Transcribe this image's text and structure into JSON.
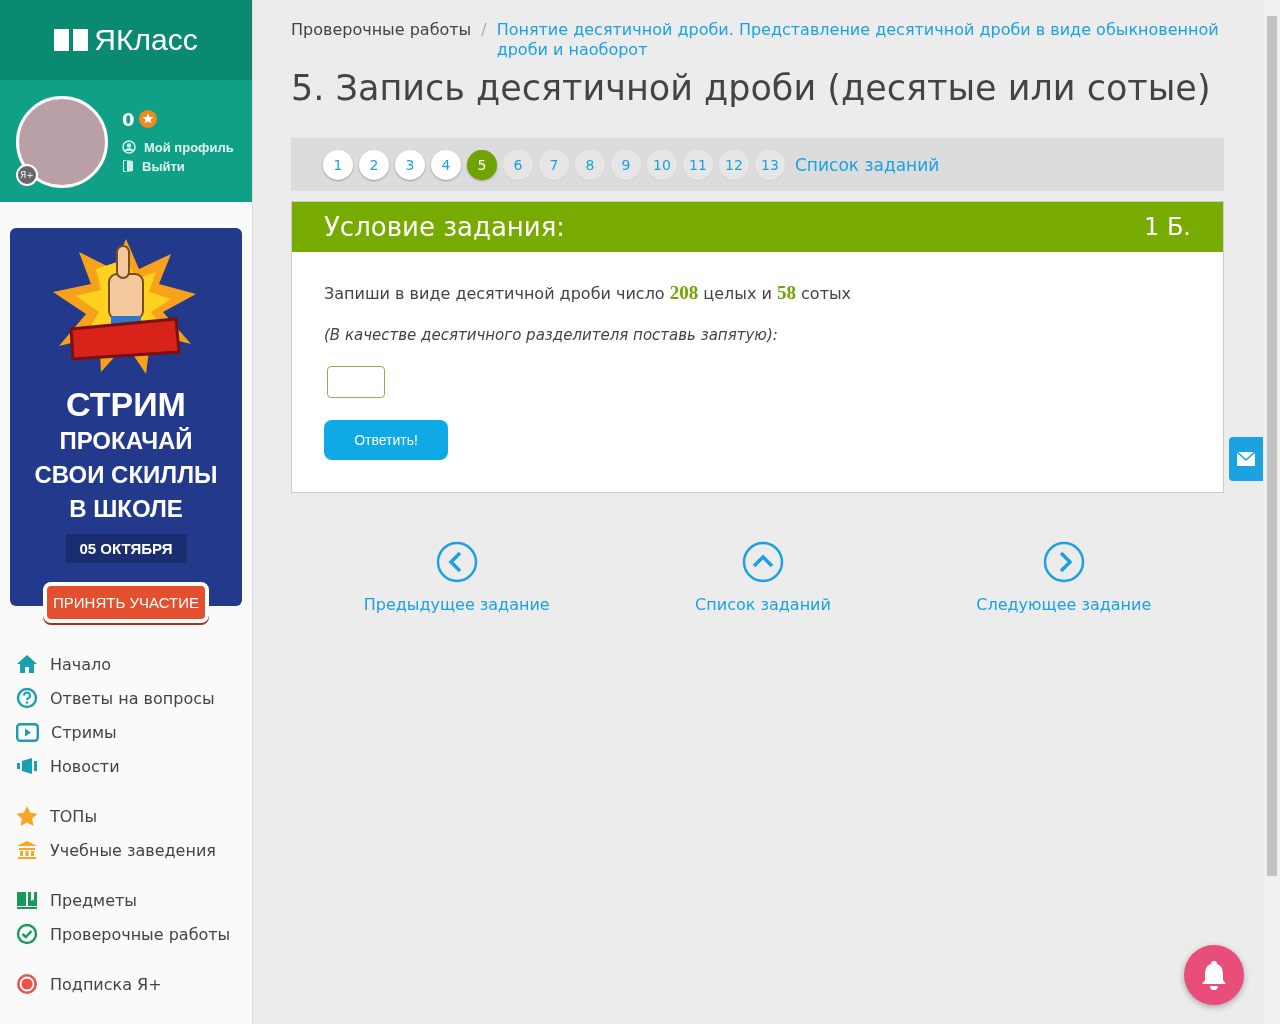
{
  "logo": {
    "text": "ЯКласс"
  },
  "profile": {
    "points": "0",
    "badge": "Я+",
    "links": [
      "Мой профиль",
      "Выйти"
    ]
  },
  "promo": {
    "headline": "СТРИМ",
    "lines": [
      "ПРОКАЧАЙ",
      "СВОИ СКИЛЛЫ",
      "В ШКОЛЕ"
    ],
    "date": "05 ОКТЯБРЯ",
    "button": "ПРИНЯТЬ УЧАСТИЕ"
  },
  "nav_groups": [
    [
      {
        "label": "Начало"
      },
      {
        "label": "Ответы на вопросы"
      },
      {
        "label": "Стримы"
      },
      {
        "label": "Новости"
      }
    ],
    [
      {
        "label": "ТОПы"
      },
      {
        "label": "Учебные заведения"
      }
    ],
    [
      {
        "label": "Предметы"
      },
      {
        "label": "Проверочные работы"
      }
    ],
    [
      {
        "label": "Подписка Я+"
      }
    ]
  ],
  "breadcrumbs": {
    "parent": "Проверочные работы",
    "separator": "/",
    "current": "Понятие десятичной дроби. Представление десятичной дроби в виде обыкновенной дроби и наоборот"
  },
  "title": "5. Запись десятичной дроби (десятые или сотые)",
  "pagination": {
    "pages": [
      {
        "label": "1",
        "selected": false,
        "visited": true
      },
      {
        "label": "2",
        "selected": false,
        "visited": true
      },
      {
        "label": "3",
        "selected": false,
        "visited": true
      },
      {
        "label": "4",
        "selected": false,
        "visited": true
      },
      {
        "label": "5",
        "selected": true,
        "visited": true
      },
      {
        "label": "6",
        "selected": false,
        "visited": false
      },
      {
        "label": "7",
        "selected": false,
        "visited": false
      },
      {
        "label": "8",
        "selected": false,
        "visited": false
      },
      {
        "label": "9",
        "selected": false,
        "visited": false
      },
      {
        "label": "10",
        "selected": false,
        "visited": false
      },
      {
        "label": "11",
        "selected": false,
        "visited": false
      },
      {
        "label": "12",
        "selected": false,
        "visited": false
      },
      {
        "label": "13",
        "selected": false,
        "visited": false
      }
    ],
    "list_link": "Список заданий"
  },
  "task": {
    "heading": "Условие задания:",
    "points": "1 Б.",
    "question": [
      {
        "kind": "text",
        "text": "Запиши в виде десятичной дроби число"
      },
      {
        "kind": "number",
        "text": "208"
      },
      {
        "kind": "text",
        "text": "целых и"
      },
      {
        "kind": "number",
        "text": "58"
      },
      {
        "kind": "text",
        "text": "сотых"
      }
    ],
    "hint": "(В качестве десятичного разделителя поставь запятую):",
    "submit": "Ответить!"
  },
  "bottom_nav": [
    "Предыдущее задание",
    "Список заданий",
    "Следующее задание"
  ]
}
